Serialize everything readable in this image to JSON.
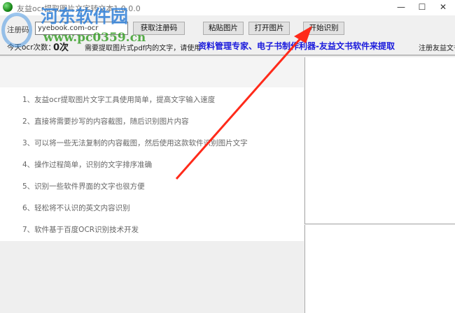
{
  "window": {
    "title": "友益ocr提取图片文字转文本1.0.0.0",
    "minimize": "—",
    "maximize": "☐",
    "close": "✕"
  },
  "toolbar": {
    "reg_label": "注册码",
    "reg_value": "yyebook.com-ocr",
    "get_code": "获取注册码",
    "paste_image": "粘贴图片",
    "open_image": "打开图片",
    "start_ocr": "开始识别",
    "count_label": "今天ocr次数：",
    "count_value": "0次",
    "hint": "需要提取图片式pdf内的文字，请使用",
    "promo_link": "资料管理专家、电子书制作利器-友益文书软件来提取",
    "register_link": "注册友益文书"
  },
  "features": [
    "1、友益ocr提取图片文字工具使用简单，提高文字输入速度",
    "2、直接将需要抄写的内容截图，随后识别图片内容",
    "3、可以将一些无法复制的内容截图，然后使用这款软件识别图片文字",
    "4、操作过程简单，识别的文字排序准确",
    "5、识别一些软件界面的文字也很方便",
    "6、轻松将不认识的英文内容识别",
    "7、软件基于百度OCR识别技术开发"
  ],
  "watermark": {
    "name": "河东软件园",
    "url": "www.pc0359.cn"
  },
  "colors": {
    "promo": "#1a1adc",
    "arrow": "#ff2a1a"
  }
}
